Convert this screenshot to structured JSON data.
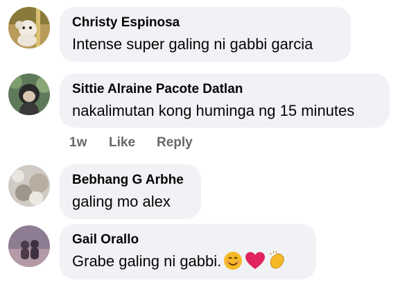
{
  "comments": [
    {
      "author": "Christy Espinosa",
      "text": "Intense super galing ni gabbi garcia"
    },
    {
      "author": "Sittie Alraine Pacote Datlan",
      "text": "nakalimutan kong huminga ng 15 minutes",
      "time": "1w",
      "like_label": "Like",
      "reply_label": "Reply"
    },
    {
      "author": "Bebhang G Arbhe",
      "text": "galing mo alex"
    },
    {
      "author": "Gail Orallo",
      "text": "Grabe galing ni gabbi.",
      "emojis": [
        "smiling-face-emoji",
        "red-heart-emoji",
        "clapping-hands-emoji"
      ]
    }
  ],
  "colors": {
    "bubble": "#f0f2f5",
    "name_text": "#050505",
    "action_text": "#65676b",
    "heart": "#e0245e",
    "smiley": "#f5b928"
  }
}
